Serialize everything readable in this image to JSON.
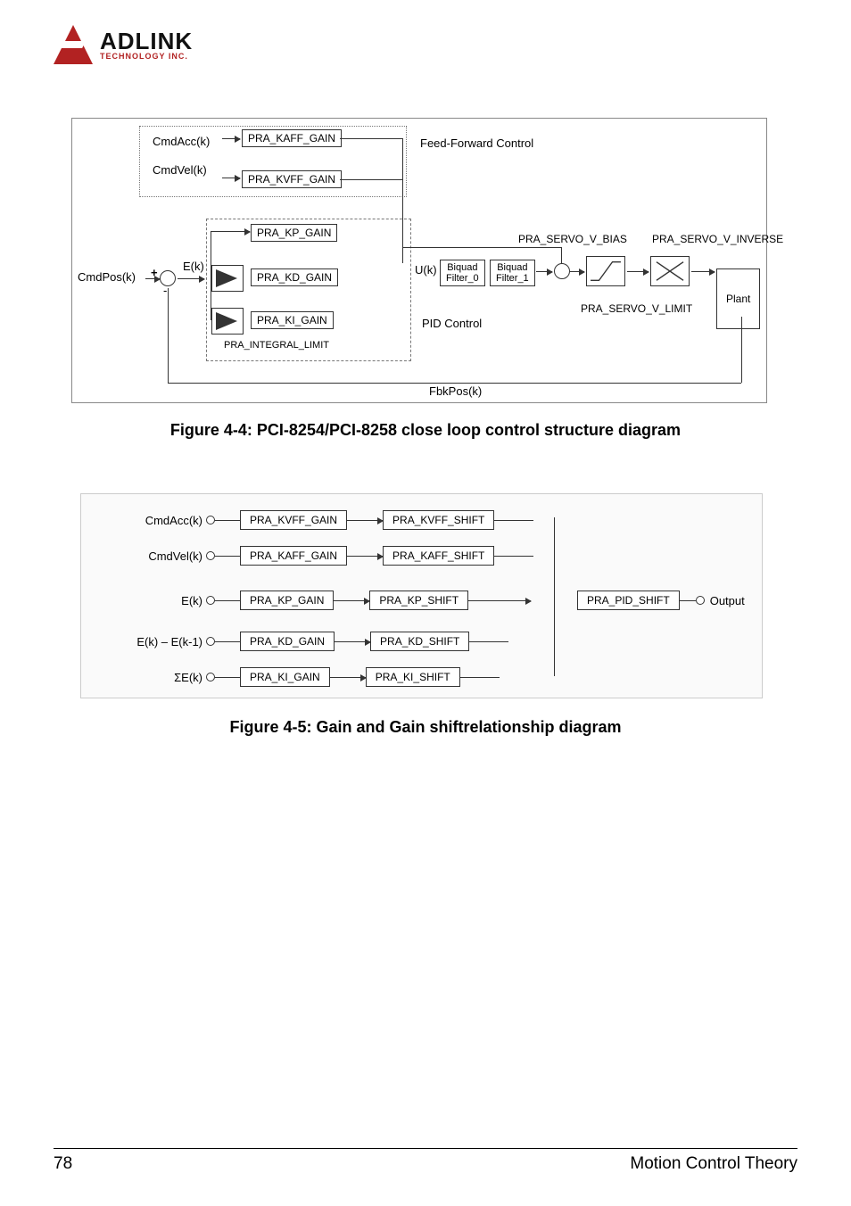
{
  "logo": {
    "main": "ADLINK",
    "sub": "TECHNOLOGY INC."
  },
  "diagram1": {
    "labels": {
      "cmdAcc": "CmdAcc(k)",
      "cmdVel": "CmdVel(k)",
      "cmdPos": "CmdPos(k)",
      "ek": "E(k)",
      "uk": "U(k)",
      "fbkPos": "FbkPos(k)",
      "ffControl": "Feed-Forward Control",
      "pidControl": "PID Control",
      "plant": "Plant",
      "plusMinus": "+",
      "minus": "-"
    },
    "boxes": {
      "kaff": "PRA_KAFF_GAIN",
      "kvff": "PRA_KVFF_GAIN",
      "kp": "PRA_KP_GAIN",
      "kd": "PRA_KD_GAIN",
      "ki": "PRA_KI_GAIN",
      "intLimit": "PRA_INTEGRAL_LIMIT",
      "biquad0": "Biquad\nFilter_0",
      "biquad1": "Biquad\nFilter_1",
      "servoBias": "PRA_SERVO_V_BIAS",
      "servoInv": "PRA_SERVO_V_INVERSE",
      "servoLimit": "PRA_SERVO_V_LIMIT"
    }
  },
  "caption1": "Figure 4-4: PCI-8254/PCI-8258 close loop control structure diagram",
  "diagram2": {
    "rows": [
      {
        "in": "CmdAcc(k)",
        "gain": "PRA_KVFF_GAIN",
        "shift": "PRA_KVFF_SHIFT"
      },
      {
        "in": "CmdVel(k)",
        "gain": "PRA_KAFF_GAIN",
        "shift": "PRA_KAFF_SHIFT"
      },
      {
        "in": "E(k)",
        "gain": "PRA_KP_GAIN",
        "shift": "PRA_KP_SHIFT"
      },
      {
        "in": "E(k) – E(k-1)",
        "gain": "PRA_KD_GAIN",
        "shift": "PRA_KD_SHIFT"
      },
      {
        "in": "ΣE(k)",
        "gain": "PRA_KI_GAIN",
        "shift": "PRA_KI_SHIFT"
      }
    ],
    "outBox": "PRA_PID_SHIFT",
    "outLabel": "Output"
  },
  "caption2": "Figure 4-5: Gain and Gain shiftrelationship diagram",
  "footer": {
    "page": "78",
    "title": "Motion Control Theory"
  }
}
